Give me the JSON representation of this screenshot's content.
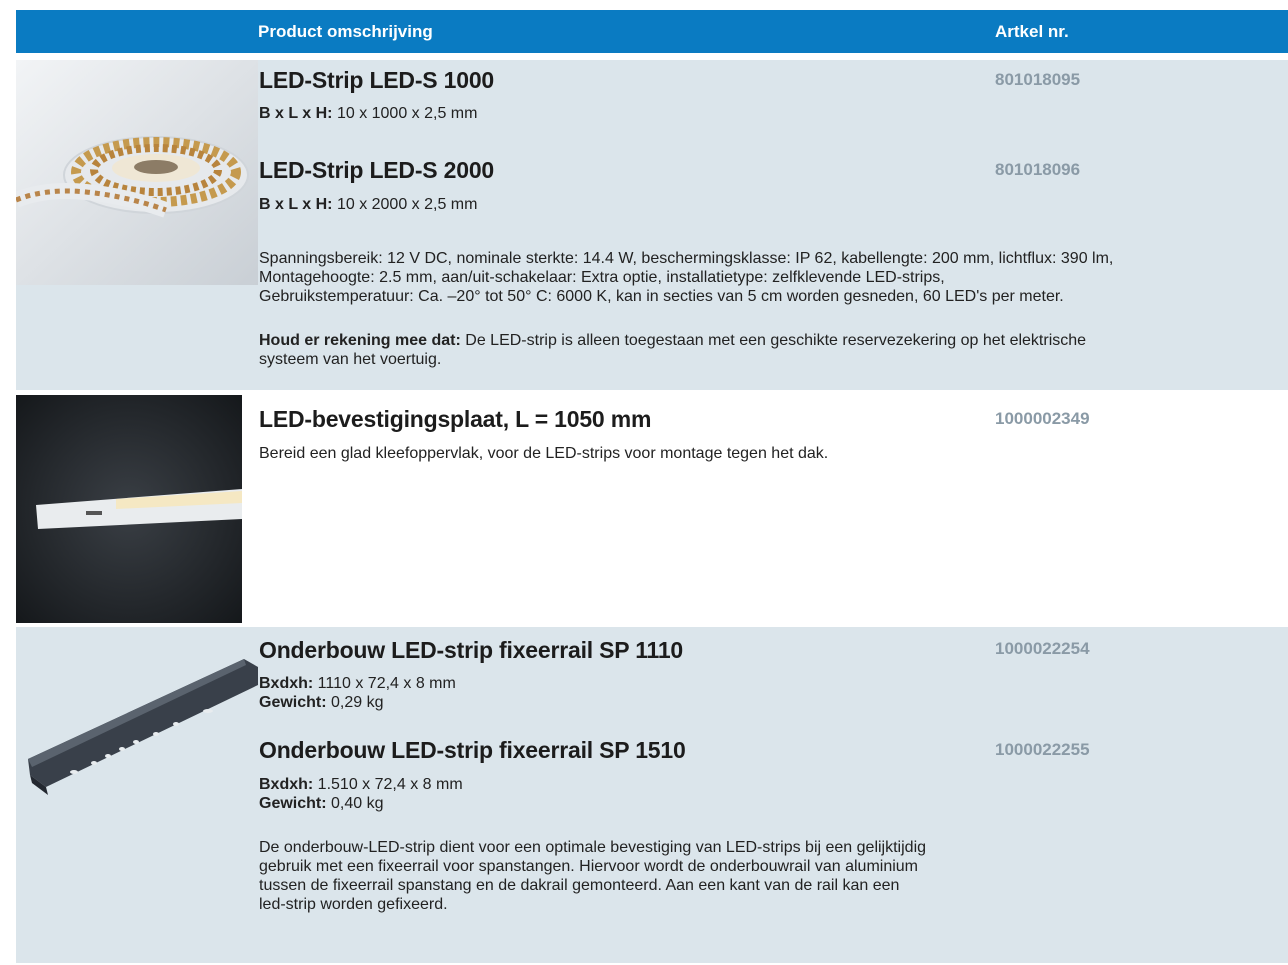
{
  "header": {
    "description_label": "Product omschrijving",
    "article_label": "Artkel nr."
  },
  "sections": [
    {
      "image_icon": "led-strip-reel-photo",
      "products": [
        {
          "title": "LED-Strip LED-S 1000",
          "artnr": "801018095",
          "spec_label": "B x L x H:",
          "spec_value": " 10 x 1000 x 2,5 mm"
        },
        {
          "title": "LED-Strip LED-S 2000",
          "artnr": "801018096",
          "spec_label": "B x L x H:",
          "spec_value": " 10 x 2000 x 2,5 mm"
        }
      ],
      "description_lines": [
        "Spanningsbereik: 12 V DC, nominale sterkte: 14.4 W, beschermingsklasse: IP 62, kabellengte: 200 mm, lichtflux: 390 lm,",
        "Montagehoogte: 2.5 mm, aan/uit-schakelaar: Extra optie, installatietype: zelfklevende LED-strips,",
        "Gebruikstemperatuur: Ca. –20° tot 50° C: 6000 K, kan in secties van 5 cm worden gesneden, 60 LED's per meter."
      ],
      "note_label": "Houd er rekening mee dat:",
      "note_line1": " De LED-strip is alleen toegestaan met een geschikte reservezekering op het elektrische",
      "note_line2": "systeem van het voertuig."
    },
    {
      "image_icon": "led-mounting-plate-photo",
      "products": [
        {
          "title": "LED-bevestigingsplaat, L = 1050 mm",
          "artnr": "1000002349"
        }
      ],
      "description": "Bereid een glad kleefoppervlak, voor de LED-strips voor montage tegen het dak."
    },
    {
      "image_icon": "mounting-rail-photo",
      "products": [
        {
          "title": "Onderbouw LED-strip fixeerrail SP 1110",
          "artnr": "1000022254",
          "dim_label": "Bxdxh:",
          "dim_value": " 1110 x 72,4 x 8 mm",
          "weight_label": "Gewicht:",
          "weight_value": " 0,29 kg"
        },
        {
          "title": "Onderbouw LED-strip fixeerrail SP 1510",
          "artnr": "1000022255",
          "dim_label": "Bxdxh:",
          "dim_value": " 1.510 x 72,4 x 8 mm",
          "weight_label": "Gewicht:",
          "weight_value": " 0,40 kg"
        }
      ],
      "description_lines": [
        "De onderbouw-LED-strip dient voor een optimale bevestiging van LED-strips bij een gelijktijdig",
        "gebruik met een fixeerrail voor spanstangen. Hiervoor wordt de onderbouwrail van aluminium",
        "tussen de fixeerrail spanstang en de dakrail gemonteerd. Aan een kant van de rail kan een",
        "led-strip worden gefixeerd."
      ]
    }
  ],
  "colors": {
    "header_bg": "#0a7bc2",
    "row_shade": "#dbe5eb",
    "artnr_text": "#8a9aa6"
  }
}
